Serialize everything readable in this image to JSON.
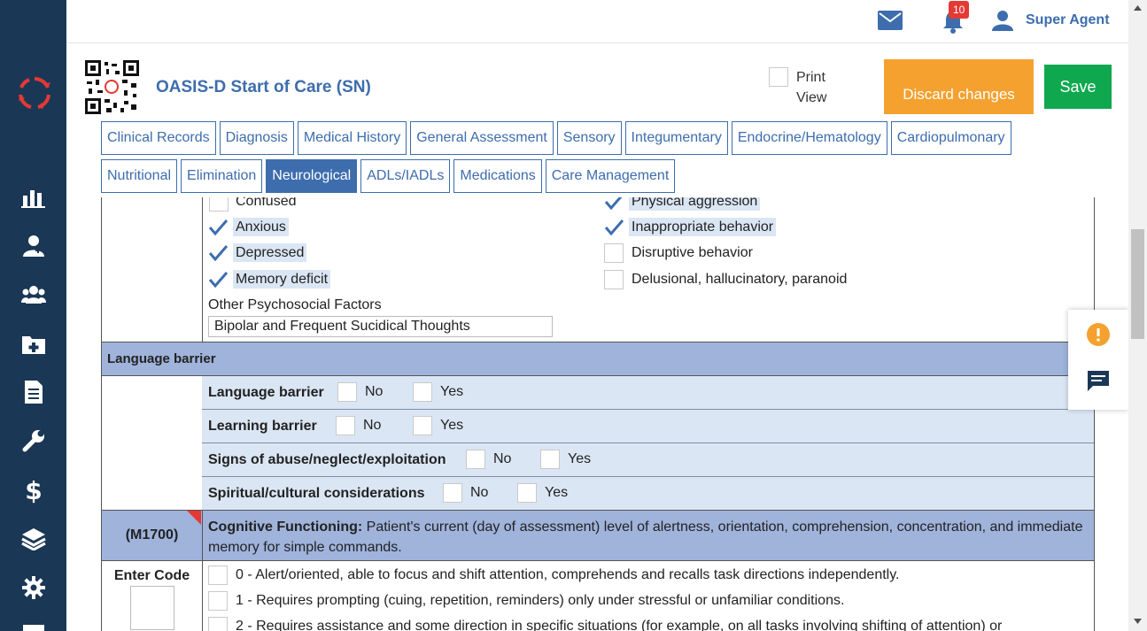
{
  "topbar": {
    "notification_count": "10",
    "user_name": "Super Agent"
  },
  "header": {
    "title": "OASIS-D Start of Care (SN)",
    "print_view_label": "Print View",
    "discard_label": "Discard changes",
    "save_label": "Save"
  },
  "tabs_row1": [
    "Clinical Records",
    "Diagnosis",
    "Medical History",
    "General Assessment",
    "Sensory",
    "Integumentary",
    "Endocrine/Hematology",
    "Cardiopulmonary"
  ],
  "tabs_row2": [
    "Nutritional",
    "Elimination",
    "Neurological",
    "ADLs/IADLs",
    "Medications",
    "Care Management"
  ],
  "active_tab": "Neurological",
  "behaviors": {
    "left": [
      {
        "label": "Confused",
        "checked": false
      },
      {
        "label": "Anxious",
        "checked": true
      },
      {
        "label": "Depressed",
        "checked": true
      },
      {
        "label": "Memory deficit",
        "checked": true
      }
    ],
    "right": [
      {
        "label": "Physical aggression",
        "checked": true
      },
      {
        "label": "Inappropriate behavior",
        "checked": true
      },
      {
        "label": "Disruptive behavior",
        "checked": false
      },
      {
        "label": "Delusional, hallucinatory, paranoid",
        "checked": false
      }
    ],
    "other_label": "Other Psychosocial Factors",
    "other_value": "Bipolar and Frequent Sucidical Thoughts"
  },
  "language_section": {
    "heading": "Language barrier",
    "no_label": "No",
    "yes_label": "Yes",
    "questions": [
      "Language barrier",
      "Learning barrier",
      "Signs of abuse/neglect/exploitation",
      "Spiritual/cultural considerations"
    ]
  },
  "cognitive": {
    "code": "(M1700)",
    "title": "Cognitive Functioning:",
    "description": "Patient's current (day of assessment) level of alertness, orientation, comprehension, concentration, and immediate memory for simple commands.",
    "enter_code_label": "Enter Code",
    "options": [
      "0 - Alert/oriented, able to focus and shift attention, comprehends and recalls task directions independently.",
      "1 - Requires prompting (cuing, repetition, reminders) only under stressful or unfamiliar conditions.",
      "2 - Requires assistance and some direction in specific situations (for example, on all tasks involving shifting of attention) or"
    ]
  },
  "colors": {
    "nav": "#1b3756",
    "brand_blue": "#3d6dad",
    "discard": "#f4a12f",
    "save": "#0fa84e",
    "section_head": "#9fb3db",
    "row_bg": "#dbe6f4",
    "warning": "#f4a12f"
  },
  "icons": [
    "logo-icon",
    "chart-icon",
    "patient-icon",
    "group-icon",
    "folder-add-icon",
    "document-icon",
    "wrench-icon",
    "dollar-icon",
    "layers-icon",
    "gear-icon",
    "mail-icon",
    "bell-icon",
    "user-icon",
    "warning-icon",
    "chat-icon"
  ]
}
